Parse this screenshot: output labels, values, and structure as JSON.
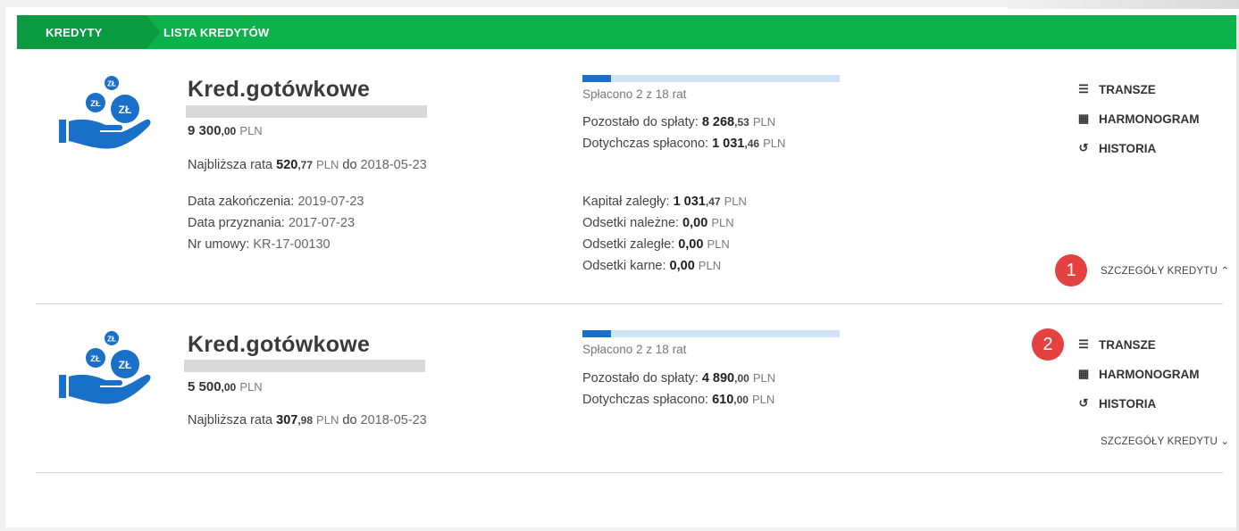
{
  "breadcrumb": {
    "first": "KREDYTY",
    "second": "LISTA KREDYTÓW"
  },
  "colors": {
    "brand_green": "#0bb24a",
    "brand_green_dark": "#0a9a3f",
    "icon_blue": "#1a6fc9",
    "badge_red": "#e44141"
  },
  "loans": [
    {
      "name": "Kred.gotówkowe",
      "amount_int": "9 300",
      "amount_dec": ",00",
      "currency": "PLN",
      "next_rate_label": "Najbliższa rata",
      "next_rate_int": "520",
      "next_rate_dec": ",77",
      "next_rate_date_label": "do",
      "next_rate_date": "2018-05-23",
      "end_date_label": "Data zakończenia:",
      "end_date": "2019-07-23",
      "grant_date_label": "Data przyznania:",
      "grant_date": "2017-07-23",
      "contract_label": "Nr umowy:",
      "contract_no": "KR-17-00130",
      "paid_text": "Spłacono 2 z 18 rat",
      "progress_fraction": 0.111,
      "remaining_label": "Pozostało do spłaty:",
      "remaining_int": "8 268",
      "remaining_dec": ",53",
      "paid_so_far_label": "Dotychczas spłacono:",
      "paid_so_far_int": "1 031",
      "paid_so_far_dec": ",46",
      "capital_overdue_label": "Kapitał zaległy:",
      "capital_overdue_int": "1 031",
      "capital_overdue_dec": ",47",
      "interest_due_label": "Odsetki należne:",
      "interest_due": "0,00",
      "interest_overdue_label": "Odsetki zaległe:",
      "interest_overdue": "0,00",
      "penalty_interest_label": "Odsetki karne:",
      "penalty_interest": "0,00",
      "actions": [
        "TRANSZE",
        "HARMONOGRAM",
        "HISTORIA"
      ],
      "details_label": "SZCZEGÓŁY KREDYTU",
      "details_chevron": "⌃",
      "badge": "1"
    },
    {
      "name": "Kred.gotówkowe",
      "amount_int": "5 500",
      "amount_dec": ",00",
      "currency": "PLN",
      "next_rate_label": "Najbliższa rata",
      "next_rate_int": "307",
      "next_rate_dec": ",98",
      "next_rate_date_label": "do",
      "next_rate_date": "2018-05-23",
      "paid_text": "Spłacono 2 z 18 rat",
      "progress_fraction": 0.111,
      "remaining_label": "Pozostało do spłaty:",
      "remaining_int": "4 890",
      "remaining_dec": ",00",
      "paid_so_far_label": "Dotychczas spłacono:",
      "paid_so_far_int": "610",
      "paid_so_far_dec": ",00",
      "actions": [
        "TRANSZE",
        "HARMONOGRAM",
        "HISTORIA"
      ],
      "details_label": "SZCZEGÓŁY KREDYTU",
      "details_chevron": "⌄",
      "badge": "2"
    }
  ],
  "icons": {
    "coin_label": "ZŁ",
    "transze": "list-icon",
    "harmonogram": "calendar-icon",
    "historia": "history-icon"
  }
}
